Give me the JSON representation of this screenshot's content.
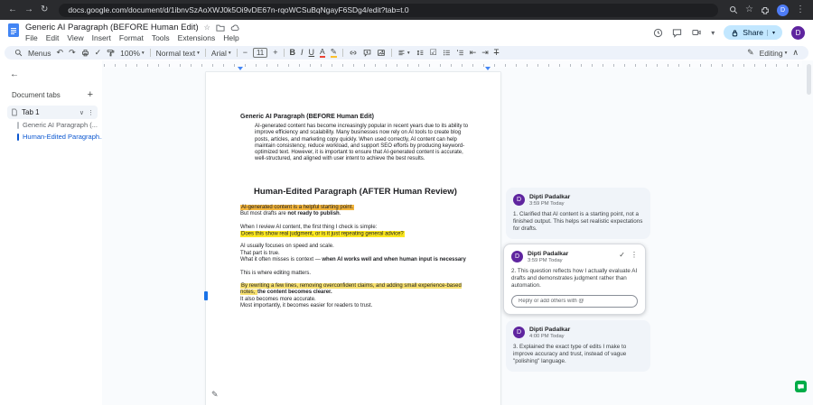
{
  "colors": {
    "accent_blue": "#1a73e8",
    "share_pill": "#c2e7ff",
    "highlight_orange": "#f3b53c",
    "highlight_active_yellow": "#fbe71e",
    "highlight_soft_yellow": "#f8e170",
    "avatar_purple": "#5f259f",
    "chat_green": "#00ac47"
  },
  "icons": {
    "back": "←",
    "forward": "→",
    "reload": "↻",
    "overflow": "⋮",
    "bookmark_star": "☆",
    "star": "☆",
    "add": "+",
    "undo": "↶",
    "redo": "↷",
    "spellcheck": "✓",
    "chevron_down": "▾",
    "collapse": "∧",
    "expand": "∨",
    "minus": "−",
    "plus": "+",
    "bold": "B",
    "italic": "I",
    "underline": "U",
    "text_color": "A",
    "highlight": "✎",
    "checklist": "☑",
    "indent_less": "⇤",
    "indent_more": "⇥",
    "clear_format": "T",
    "kebab": "⋮",
    "resolve_check": "✓",
    "pen": "✎"
  },
  "browser": {
    "url": "docs.google.com/document/d/1ibnvSzAoXWJ0k5Oi9vDE67n-rqoWCSuBqNgayF6SDg4/edit?tab=t.0",
    "avatar_initial": "D"
  },
  "header": {
    "title": "Generic AI Paragraph (BEFORE Human Edit)",
    "menus": [
      "File",
      "Edit",
      "View",
      "Insert",
      "Format",
      "Tools",
      "Extensions",
      "Help"
    ],
    "share_label": "Share",
    "avatar_initial": "D"
  },
  "toolbar": {
    "menus_label": "Menus",
    "zoom_value": "100%",
    "paragraph_style": "Normal text",
    "font_family": "Arial",
    "font_size": "11",
    "mode": "Editing"
  },
  "sidebar": {
    "title": "Document tabs",
    "tab": {
      "label": "Tab 1"
    },
    "items": [
      {
        "label": "Generic AI Paragraph (..."
      },
      {
        "label": "Human-Edited Paragraph..."
      }
    ]
  },
  "doc": {
    "h1": "Generic AI Paragraph (BEFORE Human Edit)",
    "p1": "AI-generated content has become increasingly popular in recent years due to its ability to improve efficiency and scalability. Many businesses now rely on AI tools to create blog posts, articles, and marketing copy quickly. When used correctly, AI content can help maintain consistency, reduce workload, and support SEO efforts by producing keyword-optimized text. However, it is important to ensure that AI-generated content is accurate, well-structured, and aligned with user intent to achieve the best results.",
    "h2": "Human-Edited Paragraph (AFTER Human Review)",
    "l1": "AI-generated content is a helpful starting point.",
    "l2a": "But most drafts are ",
    "l2b": "not ready to publish",
    "l2c": ".",
    "l3": "When I review AI content, the first thing I check is simple:",
    "l4": "Does this show real judgment, or is it just repeating general advice?",
    "l5": "AI usually focuses on speed and scale.",
    "l6": "That part is true.",
    "l7a": "What it often misses is context — ",
    "l7b": "when AI works well and when human input is necessary",
    "l8": "This is where editing matters.",
    "l9a": "By rewriting a few lines, removing overconfident claims, and adding small experience-based notes, ",
    "l9b": "the content becomes clearer.",
    "l10": "It also becomes more accurate.",
    "l11": "Most importantly, it becomes easier for readers to trust."
  },
  "comments": [
    {
      "author": "Dipti Padalkar",
      "initial": "D",
      "time": "3:59 PM Today",
      "text": "1. Clarified that AI content is a starting point, not a finished output. This helps set realistic expectations for drafts."
    },
    {
      "author": "Dipti Padalkar",
      "initial": "D",
      "time": "3:59 PM Today",
      "text": "2. This question reflects how I actually evaluate AI drafts and demonstrates judgment rather than automation.",
      "reply_placeholder": "Reply or add others with @"
    },
    {
      "author": "Dipti Padalkar",
      "initial": "D",
      "time": "4:00 PM Today",
      "text": "3. Explained the exact type of edits I make to improve accuracy and trust, instead of vague \"polishing\" language."
    }
  ]
}
